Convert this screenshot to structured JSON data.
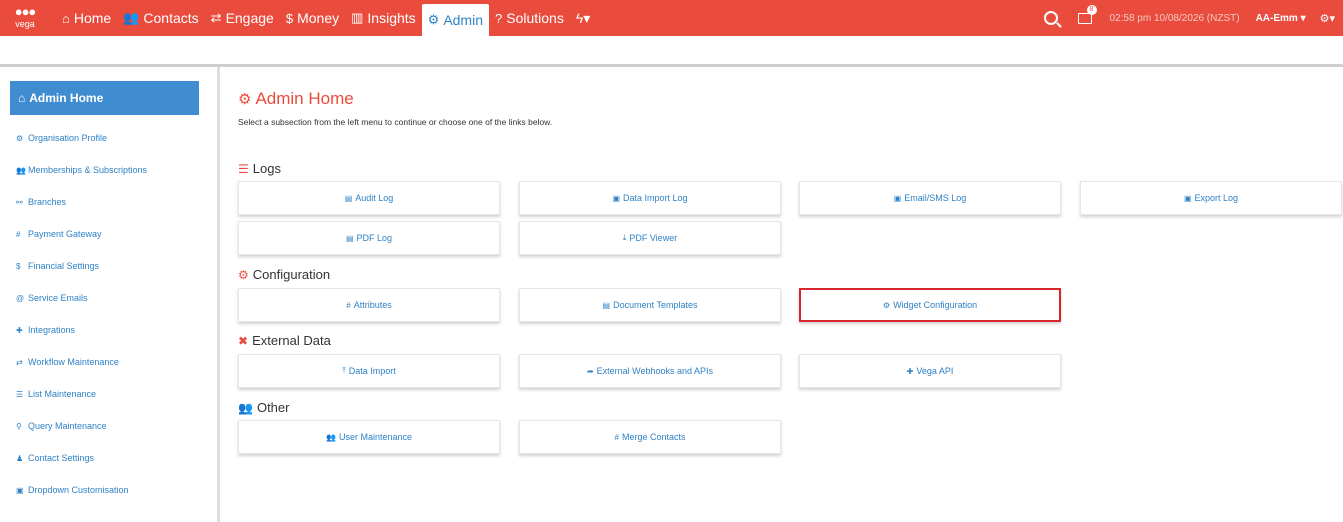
{
  "header": {
    "logo_text": "vega",
    "nav": [
      {
        "label": "Home",
        "icon": "home-icon",
        "glyph": "⌂"
      },
      {
        "label": "Contacts",
        "icon": "users-icon",
        "glyph": "👥"
      },
      {
        "label": "Engage",
        "icon": "exchange-icon",
        "glyph": "⇄"
      },
      {
        "label": "Money",
        "icon": "dollar-icon",
        "glyph": "$"
      },
      {
        "label": "Insights",
        "icon": "bar-chart-icon",
        "glyph": "▥"
      },
      {
        "label": "Admin",
        "icon": "cogs-icon",
        "glyph": "⚙"
      },
      {
        "label": "Solutions",
        "icon": "question-icon",
        "glyph": "?"
      }
    ],
    "bolt_menu_glyph": "ϟ▾",
    "mail_badge": "8",
    "clock": "02:58 pm 10/08/2026 (NZST)",
    "user": "AA-Emm ▾",
    "gear_menu": "⚙▾"
  },
  "sidebar": {
    "title": "Admin Home",
    "items": [
      {
        "label": "Organisation Profile",
        "glyph": "⚙"
      },
      {
        "label": "Memberships & Subscriptions",
        "glyph": "👥"
      },
      {
        "label": "Branches",
        "glyph": "⚯"
      },
      {
        "label": "Payment Gateway",
        "glyph": "#"
      },
      {
        "label": "Financial Settings",
        "glyph": "$"
      },
      {
        "label": "Service Emails",
        "glyph": "@"
      },
      {
        "label": "Integrations",
        "glyph": "✚"
      },
      {
        "label": "Workflow Maintenance",
        "glyph": "⇄"
      },
      {
        "label": "List Maintenance",
        "glyph": "☰"
      },
      {
        "label": "Query Maintenance",
        "glyph": "⚲"
      },
      {
        "label": "Contact Settings",
        "glyph": "♟"
      },
      {
        "label": "Dropdown Customisation",
        "glyph": "▣"
      }
    ]
  },
  "main": {
    "title": "Admin Home",
    "subtitle": "Select a subsection from the left menu to continue or choose one of the links below.",
    "sections": {
      "logs": {
        "title": "Logs",
        "buttons": [
          {
            "label": "Audit Log",
            "glyph": "▤"
          },
          {
            "label": "Data Import Log",
            "glyph": "▣"
          },
          {
            "label": "Email/SMS Log",
            "glyph": "▣"
          },
          {
            "label": "Export Log",
            "glyph": "▣"
          },
          {
            "label": "PDF Log",
            "glyph": "▤"
          },
          {
            "label": "PDF Viewer",
            "glyph": "⤓"
          }
        ]
      },
      "configuration": {
        "title": "Configuration",
        "buttons": [
          {
            "label": "Attributes",
            "glyph": "#"
          },
          {
            "label": "Document Templates",
            "glyph": "▤"
          },
          {
            "label": "Widget Configuration",
            "glyph": "⚙"
          }
        ]
      },
      "external": {
        "title": "External Data",
        "buttons": [
          {
            "label": "Data Import",
            "glyph": "⤒"
          },
          {
            "label": "External Webhooks and APIs",
            "glyph": "➦"
          },
          {
            "label": "Vega API",
            "glyph": "✚"
          }
        ]
      },
      "other": {
        "title": "Other",
        "buttons": [
          {
            "label": "User Maintenance",
            "glyph": "👥"
          },
          {
            "label": "Merge Contacts",
            "glyph": "#"
          }
        ]
      }
    }
  },
  "colors": {
    "brand_red": "#e94c3d",
    "link_blue": "#2f82c7",
    "sidebar_header_blue": "#3f8dd0",
    "highlight_red": "#d9262a"
  }
}
